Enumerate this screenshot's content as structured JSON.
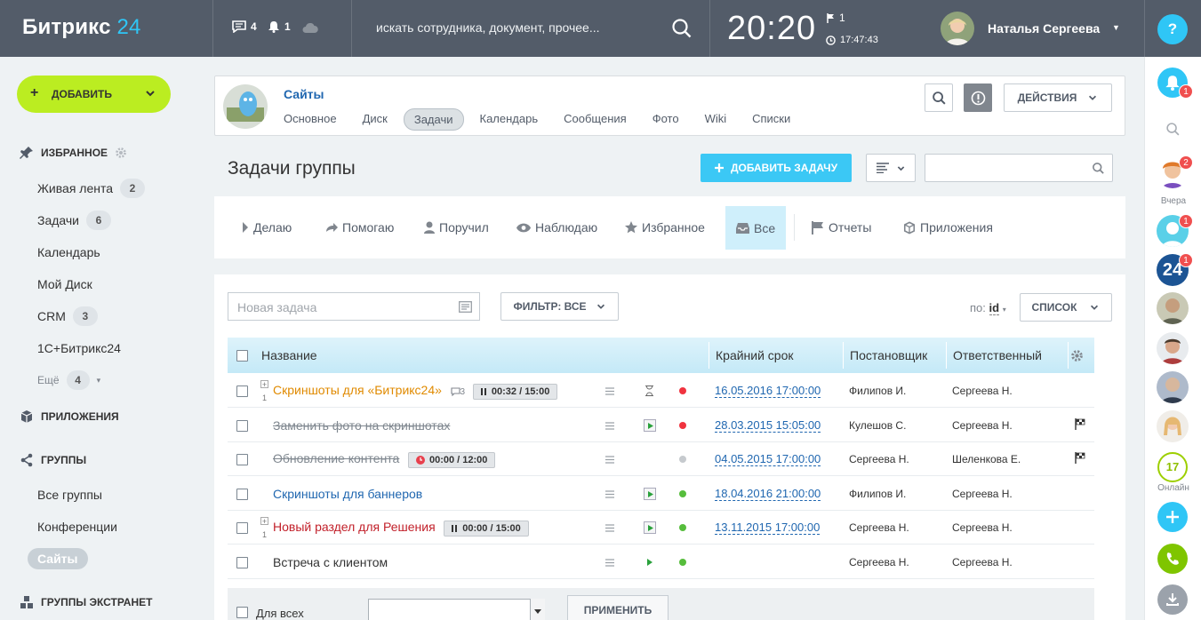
{
  "header": {
    "logo_main": "Битрикс",
    "logo_num": "24",
    "messages_count": "4",
    "notifications_count": "1",
    "search_placeholder": "искать сотрудника, документ, прочее...",
    "clock": "20:20",
    "flag_count": "1",
    "work_time": "17:47:43",
    "user_name": "Наталья Сергеева",
    "help": "?"
  },
  "sidebar": {
    "add_label": "ДОБАВИТЬ",
    "favorites_title": "ИЗБРАННОЕ",
    "items": [
      {
        "label": "Живая лента",
        "count": "2"
      },
      {
        "label": "Задачи",
        "count": "6"
      },
      {
        "label": "Календарь",
        "count": ""
      },
      {
        "label": "Мой Диск",
        "count": ""
      },
      {
        "label": "CRM",
        "count": "3"
      },
      {
        "label": "1С+Битрикс24",
        "count": ""
      }
    ],
    "more_label": "Ещё",
    "more_count": "4",
    "apps_title": "ПРИЛОЖЕНИЯ",
    "groups_title": "ГРУППЫ",
    "group_items": [
      "Все группы",
      "Конференции",
      "Сайты"
    ],
    "extranet_title": "ГРУППЫ ЭКСТРАНЕТ"
  },
  "group": {
    "name": "Сайты",
    "tabs": [
      "Основное",
      "Диск",
      "Задачи",
      "Календарь",
      "Сообщения",
      "Фото",
      "Wiki",
      "Списки"
    ],
    "active_tab": "Задачи",
    "actions_label": "ДЕЙСТВИЯ"
  },
  "page": {
    "title": "Задачи группы",
    "add_task_label": "ДОБАВИТЬ ЗАДАЧУ"
  },
  "roles": [
    "Делаю",
    "Помогаю",
    "Поручил",
    "Наблюдаю",
    "Избранное",
    "Все",
    "Отчеты",
    "Приложения"
  ],
  "toolbar": {
    "new_task_placeholder": "Новая задача",
    "filter_label": "ФИЛЬТР: ВСЕ",
    "sort_prefix": "по:",
    "sort_field": "id",
    "view_label": "СПИСОК"
  },
  "table": {
    "headers": {
      "name": "Название",
      "deadline": "Крайний срок",
      "creator": "Постановщик",
      "responsible": "Ответственный"
    },
    "rows": [
      {
        "name": "Скриншоты для «Битрикс24»",
        "comments": "3",
        "timer": "00:32 / 15:00",
        "sub": "1",
        "deadline": "16.05.2016 17:00:00",
        "creator": "Филипов И.",
        "responsible": "Сергеева Н."
      },
      {
        "name": "Заменить фото на скриншотах",
        "deadline": "28.03.2015 15:05:00",
        "creator": "Кулешов С.",
        "responsible": "Сергеева Н."
      },
      {
        "name": "Обновление контента",
        "timer": "00:00 / 12:00",
        "deadline": "04.05.2015 17:00:00",
        "creator": "Сергеева Н.",
        "responsible": "Шеленкова Е."
      },
      {
        "name": "Скриншоты для баннеров",
        "deadline": "18.04.2016 21:00:00",
        "creator": "Филипов И.",
        "responsible": "Сергеева Н."
      },
      {
        "name": "Новый раздел для Решения",
        "timer": "00:00 / 15:00",
        "sub": "1",
        "deadline": "13.11.2015 17:00:00",
        "creator": "Сергеева Н.",
        "responsible": "Сергеева Н."
      },
      {
        "name": "Встреча с клиентом",
        "deadline": "",
        "creator": "Сергеева Н.",
        "responsible": "Сергеева Н."
      }
    ]
  },
  "footer": {
    "for_all_label": "Для всех",
    "apply_label": "ПРИМЕНИТЬ"
  },
  "rightbar": {
    "notif_badge": "1",
    "avatar1_badge": "2",
    "yesterday_label": "Вчера",
    "avatar2_badge": "1",
    "b24_badge": "1",
    "b24_label": "24",
    "online_count": "17",
    "online_label": "Онлайн"
  },
  "colors": {
    "header": "#535c69",
    "accent": "#3bc8f5",
    "add_green": "#bbed21",
    "link": "#2067b0"
  }
}
